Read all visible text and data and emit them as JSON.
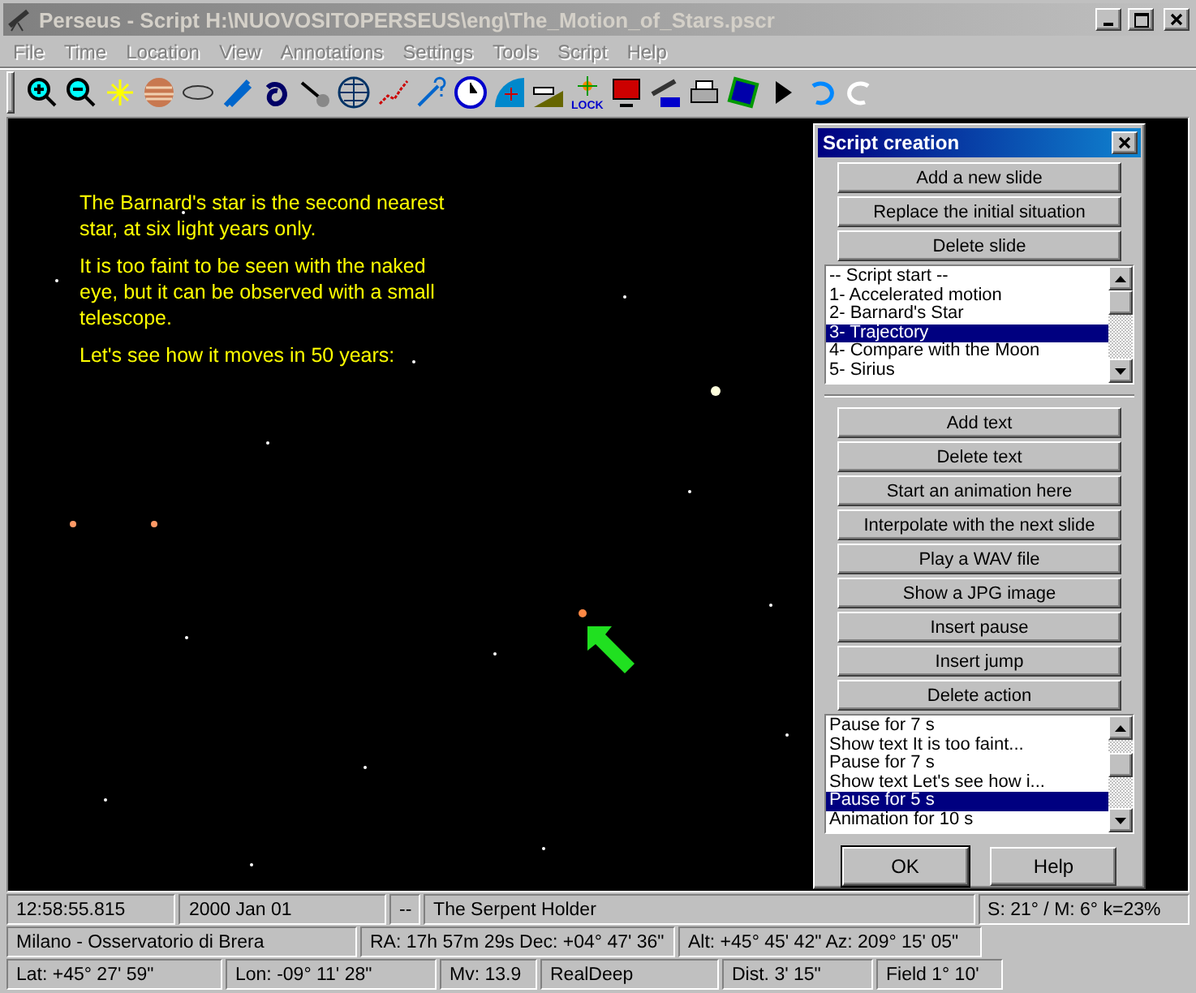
{
  "window": {
    "title": "Perseus - Script H:\\NUOVOSITOPERSEUS\\eng\\The_Motion_of_Stars.pscr",
    "active": false
  },
  "menu": [
    {
      "label": "File",
      "disabled": true
    },
    {
      "label": "Time",
      "disabled": true
    },
    {
      "label": "Location",
      "disabled": true
    },
    {
      "label": "View",
      "disabled": true
    },
    {
      "label": "Annotations",
      "disabled": true
    },
    {
      "label": "Settings",
      "disabled": true
    },
    {
      "label": "Tools",
      "disabled": true
    },
    {
      "label": "Script",
      "disabled": true
    },
    {
      "label": "Help",
      "disabled": true
    }
  ],
  "toolbar": {
    "lock_label": "LOCK"
  },
  "sky": {
    "paragraphs": [
      "The Barnard's star is the second nearest star, at six light years only.",
      "It is too faint to be seen with the naked eye, but it can be observed with a small telescope.",
      "Let's see how it moves in 50 years:"
    ]
  },
  "dialog": {
    "title": "Script creation",
    "slide_buttons": [
      "Add a new slide",
      "Replace the initial situation",
      "Delete slide"
    ],
    "slides": [
      {
        "label": "-- Script start --",
        "selected": false
      },
      {
        "label": "1- Accelerated motion",
        "selected": false
      },
      {
        "label": "2- Barnard's Star",
        "selected": false
      },
      {
        "label": "3- Trajectory",
        "selected": true
      },
      {
        "label": "4- Compare with the Moon",
        "selected": false
      },
      {
        "label": "5- Sirius",
        "selected": false
      }
    ],
    "action_buttons": [
      "Add text",
      "Delete text",
      "Start an animation here",
      "Interpolate with the next slide",
      "Play a WAV file",
      "Show a JPG image",
      "Insert pause",
      "Insert jump",
      "Delete action"
    ],
    "actions": [
      {
        "label": "Pause for 7 s",
        "selected": false
      },
      {
        "label": "Show text It is too faint...",
        "selected": false
      },
      {
        "label": "Pause for 7 s",
        "selected": false
      },
      {
        "label": "Show text Let's see how i...",
        "selected": false
      },
      {
        "label": "Pause for 5 s",
        "selected": true
      },
      {
        "label": "Animation for 10 s",
        "selected": false
      }
    ],
    "buttons": [
      {
        "label": "OK",
        "default": true
      },
      {
        "label": "Help",
        "default": false
      }
    ]
  },
  "status_bar": [
    [
      "12:58:55.815",
      "2000 Jan 01",
      "--",
      "The Serpent Holder",
      "S: 21° / M: 6° k=23%"
    ],
    [
      "Milano - Osservatorio di Brera",
      "RA: 17h 57m 29s  Dec: +04° 47' 36\"",
      "Alt: +45° 45' 42\"  Az: 209° 15' 05\""
    ],
    [
      "Lat: +45° 27' 59\"",
      "Lon: -09° 11' 28\"",
      "Mv: 13.9",
      "RealDeep",
      "Dist. 3' 15\"",
      "Field 1° 10'"
    ]
  ]
}
